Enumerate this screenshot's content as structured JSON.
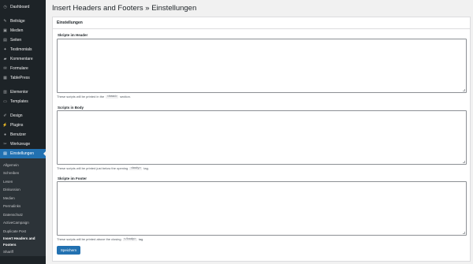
{
  "sidebar": {
    "groups": [
      [
        {
          "label": "Dashboard",
          "icon": "dashboard-icon",
          "glyph": "◷"
        }
      ],
      [
        {
          "label": "Beiträge",
          "icon": "pin-icon",
          "glyph": "✎"
        },
        {
          "label": "Medien",
          "icon": "media-icon",
          "glyph": "▣"
        },
        {
          "label": "Seiten",
          "icon": "pages-icon",
          "glyph": "▤"
        },
        {
          "label": "Testimonials",
          "icon": "testimonials-icon",
          "glyph": "✦"
        },
        {
          "label": "Kommentare",
          "icon": "comments-icon",
          "glyph": "▰"
        },
        {
          "label": "Formulare",
          "icon": "forms-icon",
          "glyph": "✉"
        },
        {
          "label": "TablePress",
          "icon": "table-icon",
          "glyph": "▦"
        }
      ],
      [
        {
          "label": "Elementor",
          "icon": "elementor-icon",
          "glyph": "▥"
        },
        {
          "label": "Templates",
          "icon": "templates-icon",
          "glyph": "▭"
        }
      ],
      [
        {
          "label": "Design",
          "icon": "design-icon",
          "glyph": "✐"
        },
        {
          "label": "Plugins",
          "icon": "plugins-icon",
          "glyph": "⚡"
        },
        {
          "label": "Benutzer",
          "icon": "users-icon",
          "glyph": "●"
        },
        {
          "label": "Werkzeuge",
          "icon": "tools-icon",
          "glyph": "✂"
        },
        {
          "label": "Einstellungen",
          "icon": "settings-icon",
          "glyph": "▤",
          "active": true
        }
      ]
    ],
    "submenu": [
      "Allgemein",
      "Schreiben",
      "Lesen",
      "Diskussion",
      "Medien",
      "Permalinks",
      "Datenschutz",
      "ActiveCampaign",
      "Duplicate Post",
      "Insert Headers and",
      "Footers",
      "Shariff"
    ]
  },
  "page": {
    "title": "Insert Headers and Footers » Einstellungen",
    "panel_title": "Einstellungen",
    "fields": [
      {
        "label": "Skripte im Header",
        "desc_before": "These scripts will be printed in the",
        "code": "<head>",
        "desc_after": "section."
      },
      {
        "label": "Scripts in Body",
        "desc_before": "These scripts will be printed just below the opening",
        "code": "<body>",
        "desc_after": "tag."
      },
      {
        "label": "Skripte im Footer",
        "desc_before": "These scripts will be printed above the closing",
        "code": "</body>",
        "desc_after": "tag."
      }
    ],
    "save_label": "Speichern"
  }
}
